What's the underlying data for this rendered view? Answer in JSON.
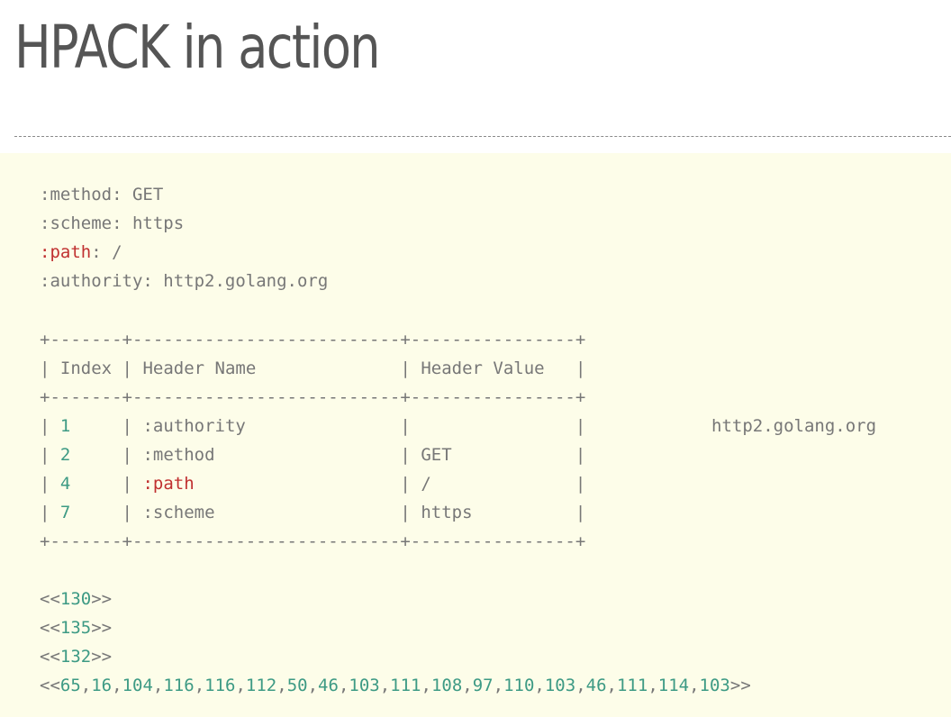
{
  "slide": {
    "title": "HPACK in action"
  },
  "headers_block": {
    "lines": [
      {
        "key": ":method",
        "sep": ": ",
        "value": "GET",
        "highlight": false
      },
      {
        "key": ":scheme",
        "sep": ": ",
        "value": "https",
        "highlight": false
      },
      {
        "key": ":path",
        "sep": ": ",
        "value": "/",
        "highlight": true
      },
      {
        "key": ":authority",
        "sep": ": ",
        "value": "http2.golang.org",
        "highlight": false
      }
    ]
  },
  "table": {
    "border": "+-------+--------------------------+----------------+",
    "columns": [
      "Index",
      "Header Name",
      "Header Value"
    ],
    "rows": [
      {
        "index": "1",
        "name": ":authority",
        "value": ""
      },
      {
        "index": "2",
        "name": ":method",
        "value": "GET"
      },
      {
        "index": "4",
        "name": ":path",
        "value": "/"
      },
      {
        "index": "7",
        "name": ":scheme",
        "value": "https"
      }
    ],
    "overflow_value": "http2.golang.org"
  },
  "encoded": {
    "open": "<<",
    "close": ">>",
    "lines": [
      [
        "130"
      ],
      [
        "135"
      ],
      [
        "132"
      ],
      [
        "65",
        "16",
        "104",
        "116",
        "116",
        "112",
        "50",
        "46",
        "103",
        "111",
        "108",
        "97",
        "110",
        "103",
        "46",
        "111",
        "114",
        "103"
      ]
    ]
  },
  "colors": {
    "highlight": "#c03030",
    "number": "#3d9a84",
    "text": "#777777",
    "panel_bg": "#fdfde9"
  }
}
